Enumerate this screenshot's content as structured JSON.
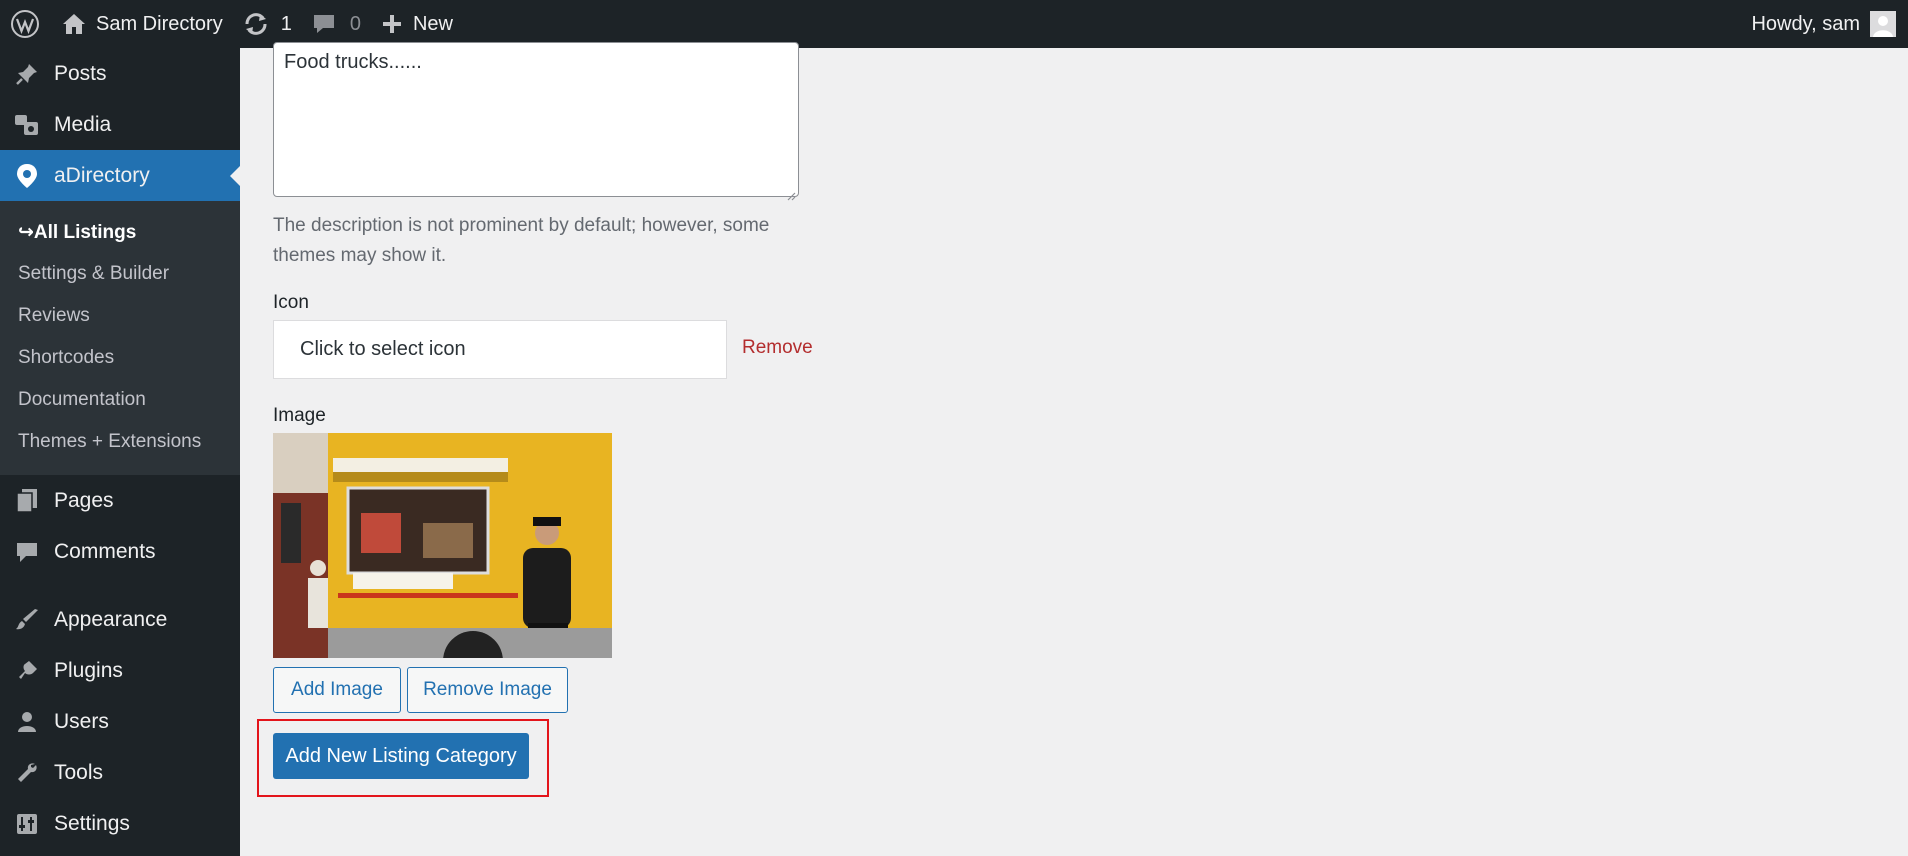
{
  "adminbar": {
    "site_name": "Sam Directory",
    "updates_count": "1",
    "comments_count": "0",
    "new_label": "New",
    "greeting": "Howdy, sam"
  },
  "sidebar": {
    "items_top": [
      {
        "label": "Posts",
        "icon": "pin-icon"
      },
      {
        "label": "Media",
        "icon": "media-icon"
      },
      {
        "label": "aDirectory",
        "icon": "location-icon"
      }
    ],
    "submenu": [
      {
        "label": "↪All Listings"
      },
      {
        "label": "Settings & Builder"
      },
      {
        "label": "Reviews"
      },
      {
        "label": "Shortcodes"
      },
      {
        "label": "Documentation"
      },
      {
        "label": "Themes + Extensions"
      }
    ],
    "items_bottom": [
      {
        "label": "Pages",
        "icon": "pages-icon"
      },
      {
        "label": "Comments",
        "icon": "comment-icon"
      },
      {
        "label": "Appearance",
        "icon": "brush-icon"
      },
      {
        "label": "Plugins",
        "icon": "plugin-icon"
      },
      {
        "label": "Users",
        "icon": "user-icon"
      },
      {
        "label": "Tools",
        "icon": "wrench-icon"
      },
      {
        "label": "Settings",
        "icon": "settings-icon"
      }
    ]
  },
  "form": {
    "description_value": "Food trucks......",
    "description_help": "The description is not prominent by default; however, some themes may show it.",
    "icon_label": "Icon",
    "icon_placeholder": "Click to select icon",
    "icon_remove": "Remove",
    "image_label": "Image",
    "image_subject": "yellow-food-truck-photo",
    "add_image": "Add Image",
    "remove_image": "Remove Image",
    "submit": "Add New Listing Category"
  },
  "colors": {
    "adminbar_bg": "#1d2327",
    "accent": "#2271b1",
    "highlight": "#e3141b",
    "remove_red": "#b32d2e"
  }
}
